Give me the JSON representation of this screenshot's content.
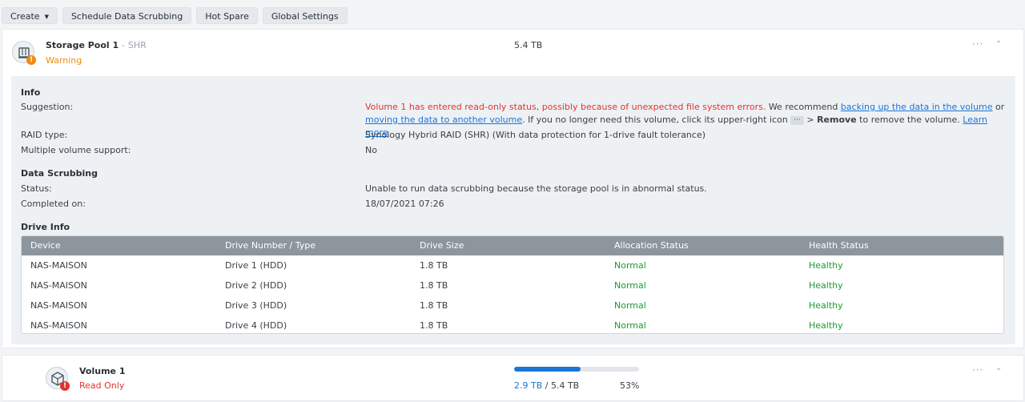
{
  "toolbar": {
    "create_label": "Create",
    "schedule_label": "Schedule Data Scrubbing",
    "hotspare_label": "Hot Spare",
    "global_label": "Global Settings"
  },
  "pool": {
    "title": "Storage Pool 1",
    "sep": "-",
    "type": "SHR",
    "status": "Warning",
    "size": "5.4 TB",
    "badge": "!",
    "more": "···",
    "chevron": "⌃"
  },
  "info": {
    "section_title": "Info",
    "suggestion_label": "Suggestion:",
    "suggestion_error": "Volume 1 has entered read-only status, possibly because of unexpected file system errors.",
    "suggestion_text1": " We recommend ",
    "suggestion_link1": "backing up the data in the volume",
    "suggestion_text2": " or ",
    "suggestion_link2": "moving the data to another volume",
    "suggestion_text3": ". If you no longer need this volume, click its upper-right icon ",
    "suggestion_icon": "···",
    "suggestion_text4": " > ",
    "suggestion_bold": "Remove",
    "suggestion_text5": " to remove the volume. ",
    "suggestion_link3": "Learn more",
    "raid_label": "RAID type:",
    "raid_value": "Synology Hybrid RAID (SHR) (With data protection for 1-drive fault tolerance)",
    "multi_label": "Multiple volume support:",
    "multi_value": "No"
  },
  "scrubbing": {
    "section_title": "Data Scrubbing",
    "status_label": "Status:",
    "status_value": "Unable to run data scrubbing because the storage pool is in abnormal status.",
    "completed_label": "Completed on:",
    "completed_value": "18/07/2021 07:26"
  },
  "drive_info": {
    "section_title": "Drive Info",
    "columns": [
      "Device",
      "Drive Number / Type",
      "Drive Size",
      "Allocation Status",
      "Health Status"
    ],
    "rows": [
      [
        "NAS-MAISON",
        "Drive 1 (HDD)",
        "1.8 TB",
        "Normal",
        "Healthy"
      ],
      [
        "NAS-MAISON",
        "Drive 2 (HDD)",
        "1.8 TB",
        "Normal",
        "Healthy"
      ],
      [
        "NAS-MAISON",
        "Drive 3 (HDD)",
        "1.8 TB",
        "Normal",
        "Healthy"
      ],
      [
        "NAS-MAISON",
        "Drive 4 (HDD)",
        "1.8 TB",
        "Normal",
        "Healthy"
      ]
    ]
  },
  "volume": {
    "title": "Volume 1",
    "status": "Read Only",
    "used": "2.9 TB",
    "sep": " / ",
    "total": "5.4 TB",
    "percent": "53%",
    "badge": "!",
    "more": "···",
    "chevron": "⌄"
  },
  "colors": {
    "warning": "#f08a0c",
    "error": "#e2332f",
    "link": "#1b74d9",
    "healthy": "#1c9a2f"
  }
}
